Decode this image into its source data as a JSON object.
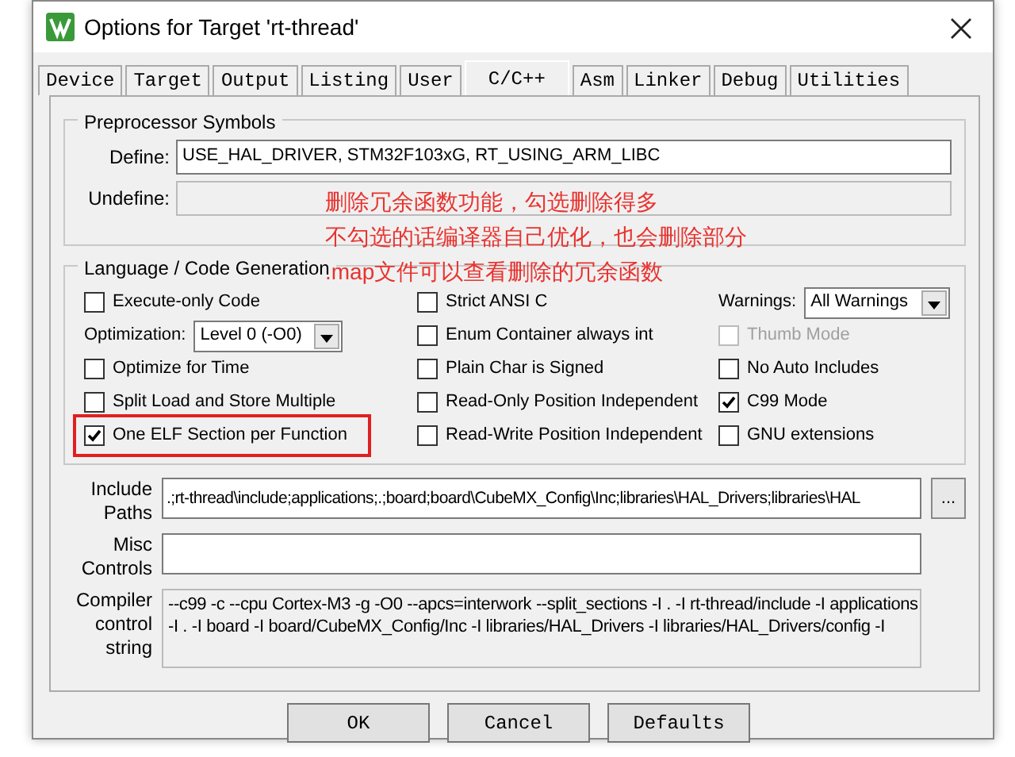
{
  "window": {
    "title": "Options for Target 'rt-thread'"
  },
  "tabs": [
    {
      "label": "Device",
      "selected": false
    },
    {
      "label": "Target",
      "selected": false
    },
    {
      "label": "Output",
      "selected": false
    },
    {
      "label": "Listing",
      "selected": false
    },
    {
      "label": "User",
      "selected": false
    },
    {
      "label": "C/C++",
      "selected": true
    },
    {
      "label": "Asm",
      "selected": false
    },
    {
      "label": "Linker",
      "selected": false
    },
    {
      "label": "Debug",
      "selected": false
    },
    {
      "label": "Utilities",
      "selected": false
    }
  ],
  "preprocessor": {
    "title": "Preprocessor Symbols",
    "fields": [
      {
        "label": "Define:",
        "value": "USE_HAL_DRIVER, STM32F103xG, RT_USING_ARM_LIBC",
        "disabled": false
      },
      {
        "label": "Undefine:",
        "disabled": true
      }
    ]
  },
  "code_generation": {
    "title": "Language / Code Generation",
    "columns": [
      [
        {
          "kind": "checkbox",
          "label": "Execute-only Code",
          "checked": false,
          "disabled": false,
          "highlighted": false
        },
        {
          "kind": "select",
          "label": "Optimization:",
          "value": "Level 0 (-O0)"
        },
        {
          "kind": "checkbox",
          "label": "Optimize for Time",
          "checked": false,
          "disabled": false,
          "highlighted": false
        },
        {
          "kind": "checkbox",
          "label": "Split Load and Store Multiple",
          "checked": false,
          "disabled": false,
          "highlighted": false
        },
        {
          "kind": "checkbox",
          "label": "One ELF Section per Function",
          "checked": true,
          "disabled": false,
          "highlighted": true
        }
      ],
      [
        {
          "kind": "checkbox",
          "label": "Strict ANSI C",
          "checked": false,
          "disabled": false,
          "highlighted": false
        },
        {
          "kind": "checkbox",
          "label": "Enum Container always int",
          "checked": false,
          "disabled": false,
          "highlighted": false
        },
        {
          "kind": "checkbox",
          "label": "Plain Char is Signed",
          "checked": false,
          "disabled": false,
          "highlighted": false
        },
        {
          "kind": "checkbox",
          "label": "Read-Only Position Independent",
          "checked": false,
          "disabled": false,
          "highlighted": false
        },
        {
          "kind": "checkbox",
          "label": "Read-Write Position Independent",
          "checked": false,
          "disabled": false,
          "highlighted": false
        }
      ],
      [
        {
          "kind": "select",
          "label": "Warnings:",
          "value": "All Warnings"
        },
        {
          "kind": "checkbox",
          "label": "Thumb Mode",
          "checked": false,
          "disabled": true,
          "highlighted": false
        },
        {
          "kind": "checkbox",
          "label": "No Auto Includes",
          "checked": false,
          "disabled": false,
          "highlighted": false
        },
        {
          "kind": "checkbox",
          "label": "C99 Mode",
          "checked": true,
          "disabled": false,
          "highlighted": false
        },
        {
          "kind": "checkbox",
          "label": "GNU extensions",
          "checked": false,
          "disabled": false,
          "highlighted": false
        }
      ]
    ]
  },
  "include_paths": {
    "label": [
      "Include",
      "Paths"
    ],
    "value": ".;rt-thread\\include;applications;.;board;board\\CubeMX_Config\\Inc;libraries\\HAL_Drivers;libraries\\HAL",
    "button": "..."
  },
  "misc_controls": {
    "label": [
      "Misc",
      "Controls"
    ]
  },
  "compiler_string": {
    "label": [
      "Compiler",
      "control",
      "string"
    ],
    "lines": [
      "--c99 -c --cpu Cortex-M3 -g -O0 --apcs=interwork --split_sections -I . -I rt-thread/include -I applications",
      "-I . -I board -I board/CubeMX_Config/Inc -I libraries/HAL_Drivers -I libraries/HAL_Drivers/config -I"
    ]
  },
  "buttons": [
    "OK",
    "Cancel",
    "Defaults"
  ],
  "annotation": [
    "删除冗余函数功能，勾选删除得多",
    "不勾选的话编译器自己优化，也会删除部分",
    ".map文件可以查看删除的冗余函数"
  ]
}
